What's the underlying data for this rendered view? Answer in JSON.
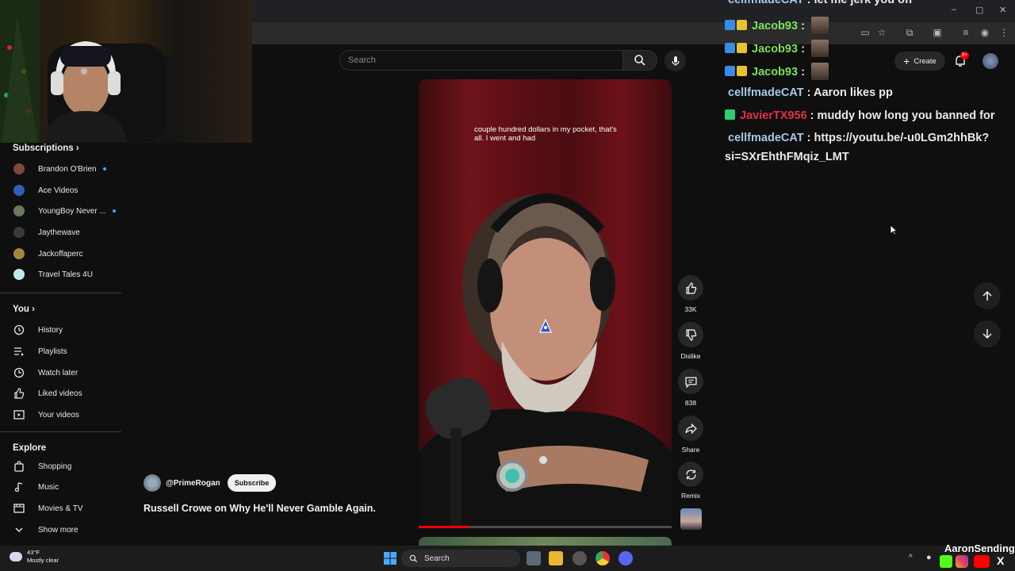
{
  "browser": {
    "window_controls": [
      "–",
      "▢",
      "✕"
    ]
  },
  "header": {
    "search_placeholder": "Search",
    "create_label": "Create",
    "notification_count": "9+"
  },
  "sidebar": {
    "subscriptions_title": "Subscriptions",
    "subscriptions": [
      {
        "label": "Brandon O'Brien",
        "color": "#7a4a3a",
        "live_dot": true
      },
      {
        "label": "Ace Videos",
        "color": "#2f5fb8",
        "live_dot": false
      },
      {
        "label": "YoungBoy Never ...",
        "color": "#6a7a5a",
        "live_dot": true
      },
      {
        "label": "Jaythewave",
        "color": "#3a3a3a",
        "live_dot": false
      },
      {
        "label": "Jackoffaperc",
        "color": "#a08a3a",
        "live_dot": false
      },
      {
        "label": "Travel Tales 4U",
        "color": "#bfe8e8",
        "live_dot": false
      }
    ],
    "you_title": "You",
    "you_items": [
      {
        "label": "History",
        "icon": "history-icon"
      },
      {
        "label": "Playlists",
        "icon": "playlists-icon"
      },
      {
        "label": "Watch later",
        "icon": "clock-icon"
      },
      {
        "label": "Liked videos",
        "icon": "thumbs-up-icon"
      },
      {
        "label": "Your videos",
        "icon": "video-icon"
      }
    ],
    "explore_title": "Explore",
    "explore_items": [
      {
        "label": "Shopping",
        "icon": "shopping-bag-icon"
      },
      {
        "label": "Music",
        "icon": "music-note-icon"
      },
      {
        "label": "Movies & TV",
        "icon": "film-icon"
      },
      {
        "label": "Show more",
        "icon": "chevron-down-icon"
      }
    ]
  },
  "video": {
    "caption": "couple hundred dollars in my pocket, that's all. I went and had",
    "progress_fraction": 0.2,
    "channel_handle": "@PrimeRogan",
    "subscribe_label": "Subscribe",
    "title": "Russell Crowe on Why He'll Never Gamble Again.",
    "actions": {
      "likes": "33K",
      "dislike_label": "Dislike",
      "comments": "838",
      "share_label": "Share",
      "remix_label": "Remix"
    }
  },
  "chat": [
    {
      "user": "cellfmadeCAT",
      "color": "#a8c8e8",
      "text": "let me jerk you off",
      "badges": 0,
      "emote": false
    },
    {
      "user": "Jacob93",
      "color": "#7be05a",
      "text": "",
      "badges": 2,
      "emote": true
    },
    {
      "user": "Jacob93",
      "color": "#7be05a",
      "text": "",
      "badges": 2,
      "emote": true
    },
    {
      "user": "Jacob93",
      "color": "#7be05a",
      "text": "",
      "badges": 2,
      "emote": true
    },
    {
      "user": "cellfmadeCAT",
      "color": "#a8c8e8",
      "text": "Aaron likes pp",
      "badges": 0,
      "emote": false
    },
    {
      "user": "JavierTX956",
      "color": "#e0304a",
      "text": "muddy how long you banned for",
      "badges": 1,
      "emote": false
    },
    {
      "user": "cellfmadeCAT",
      "color": "#a8c8e8",
      "text": "https://youtu.be/-u0LGm2hhBk?",
      "badges": 0,
      "emote": false
    }
  ],
  "chat_continuation": "si=SXrEhthFMqiz_LMT",
  "taskbar": {
    "weather_temp": "43°F",
    "weather_desc": "Mostly clear",
    "search_label": "Search",
    "overlay_name": "AaronSending"
  }
}
